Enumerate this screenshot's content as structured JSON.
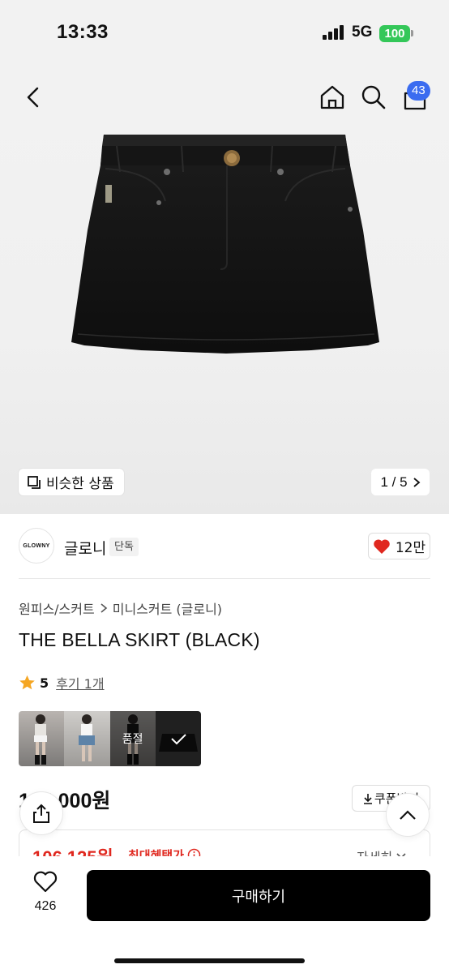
{
  "status_bar": {
    "time": "13:33",
    "network": "5G",
    "battery": "100"
  },
  "header": {
    "cart_count": "43"
  },
  "gallery": {
    "similar_label": "비슷한 상품",
    "pager": "1 / 5"
  },
  "brand": {
    "logo_text": "GLOWNY",
    "name": "글로니",
    "tag": "단독",
    "likes": "12만"
  },
  "breadcrumb": {
    "category": "원피스/스커트",
    "subcategory": "미니스커트 (글로니)"
  },
  "product": {
    "title": "THE BELLA SKIRT (BLACK)",
    "rating": "5",
    "reviews": "후기 1개",
    "sold_out_label": "품절"
  },
  "price": {
    "original": "125,000원",
    "coupon_label": "쿠폰받기",
    "benefit_price": "106,125원",
    "benefit_label": "최대혜택가",
    "detail_label": "자세히"
  },
  "bottom_bar": {
    "wish_count": "426",
    "buy_label": "구매하기"
  },
  "colors": {
    "accent_red": "#e0281f",
    "badge_blue": "#3b6cf0",
    "battery_green": "#34c759"
  }
}
